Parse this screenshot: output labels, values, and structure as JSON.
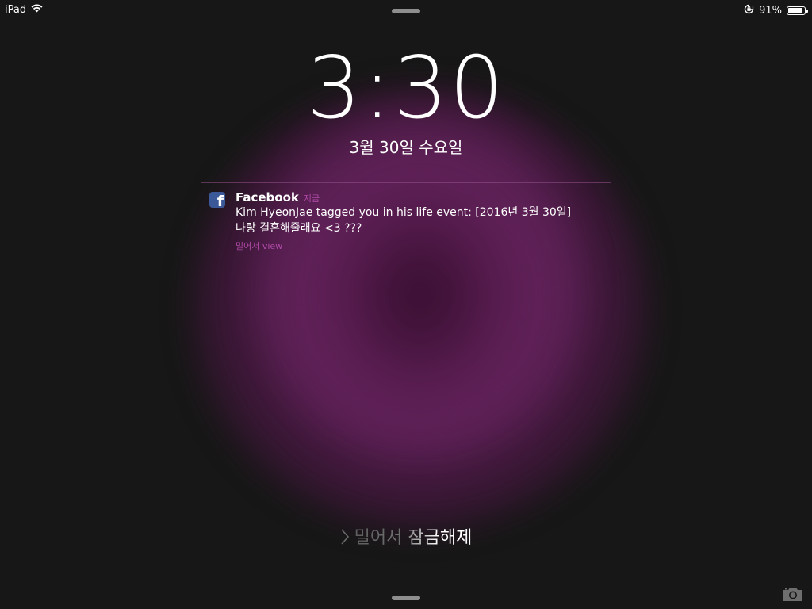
{
  "status_bar": {
    "device": "iPad",
    "battery_percent": "91%",
    "battery_level": 0.91,
    "icons": [
      "wifi-icon",
      "rotation-lock-icon",
      "battery-icon"
    ]
  },
  "lock_screen": {
    "time": "3:30",
    "date": "3월 30일 수요일",
    "unlock_text": "밀어서 잠금해제"
  },
  "notification": {
    "app_name": "Facebook",
    "app_icon": "facebook-icon",
    "time": "지금",
    "text_line1": "Kim HyeonJae tagged you in his life event: [2016년 3월 30일]",
    "text_line2": "나랑 결혼해줄래요 <3 ???",
    "action": "밀어서 view"
  },
  "colors": {
    "accent": "#b04aa8",
    "background": "#171717",
    "glow": "#6a2060"
  }
}
